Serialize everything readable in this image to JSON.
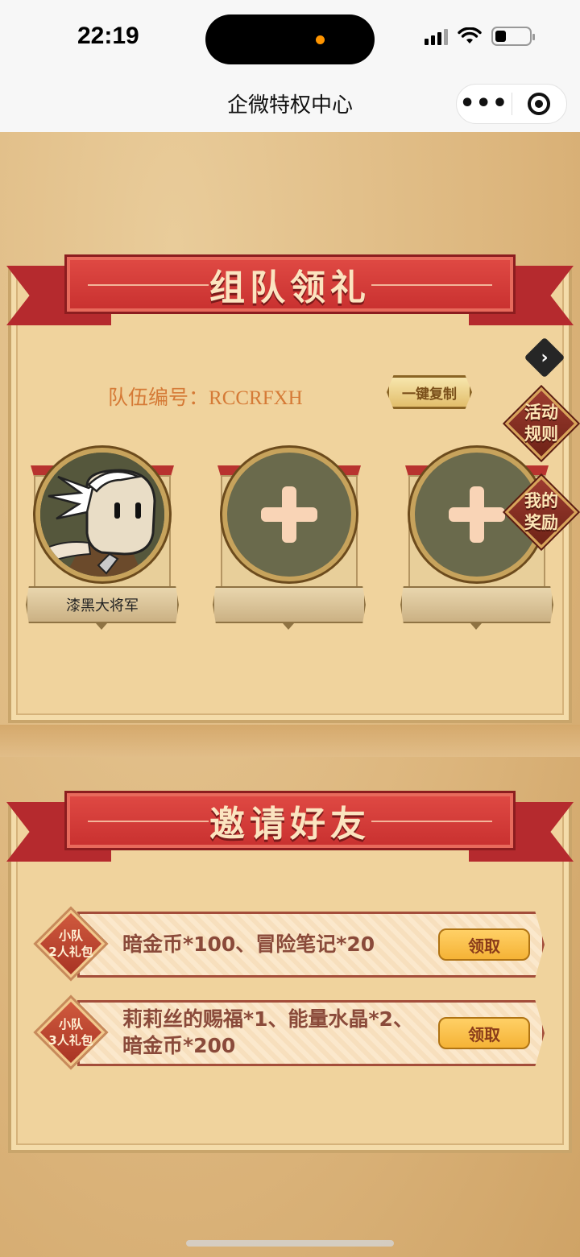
{
  "status_bar": {
    "time": "22:19"
  },
  "nav": {
    "title": "企微特权中心"
  },
  "team_section": {
    "banner": "组队领礼",
    "team_id_label": "队伍编号：",
    "team_id": "RCCRFXH",
    "copy_button": "一键复制",
    "rules_button": [
      "活动",
      "规则"
    ],
    "rewards_button": [
      "我的",
      "奖励"
    ],
    "members": [
      {
        "name": "漆黑大将军",
        "filled": true
      },
      {
        "name": "",
        "filled": false
      },
      {
        "name": "",
        "filled": false
      }
    ]
  },
  "invite_section": {
    "banner": "邀请好友",
    "rewards": [
      {
        "badge": [
          "小队",
          "2人礼包"
        ],
        "lines": [
          "暗金币*100、冒险笔记*20"
        ],
        "button": "领取"
      },
      {
        "badge": [
          "小队",
          "3人礼包"
        ],
        "lines": [
          "莉莉丝的赐福*1、能量水晶*2、",
          "暗金币*200"
        ],
        "button": "领取"
      }
    ]
  },
  "colors": {
    "ribbon": "#c8302f",
    "panel": "#f0d39d",
    "team_id_text": "#d57a36",
    "claim_button": "#f5b336"
  }
}
